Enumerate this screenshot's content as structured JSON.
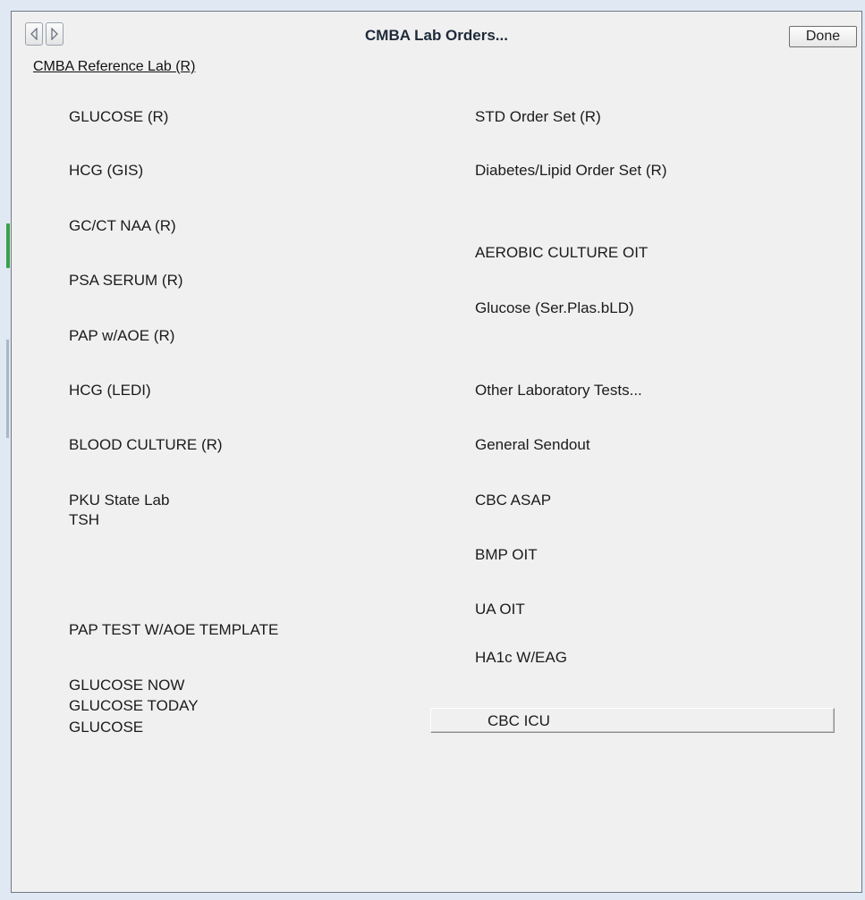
{
  "window": {
    "title": "CMBA Lab Orders...",
    "done_label": "Done",
    "back_icon": "left-arrow-icon",
    "forward_icon": "right-arrow-icon"
  },
  "section": {
    "heading": "CMBA Reference Lab (R)"
  },
  "left_column": [
    "GLUCOSE (R)",
    "HCG (GIS)",
    "GC/CT NAA (R)",
    "PSA SERUM (R)",
    "PAP w/AOE (R)",
    "HCG (LEDI)",
    "BLOOD CULTURE (R)",
    "PKU State Lab",
    "TSH",
    "PAP TEST W/AOE TEMPLATE",
    "GLUCOSE NOW",
    "GLUCOSE TODAY",
    "GLUCOSE"
  ],
  "right_column": [
    "STD Order Set (R)",
    "Diabetes/Lipid Order Set (R)",
    "AEROBIC CULTURE OIT",
    "Glucose (Ser.Plas.bLD)",
    "Other Laboratory Tests...",
    "General Sendout",
    "CBC ASAP",
    "BMP OIT",
    "UA OIT",
    "HA1c W/EAG"
  ],
  "bottom_button": {
    "label": "CBC ICU"
  }
}
